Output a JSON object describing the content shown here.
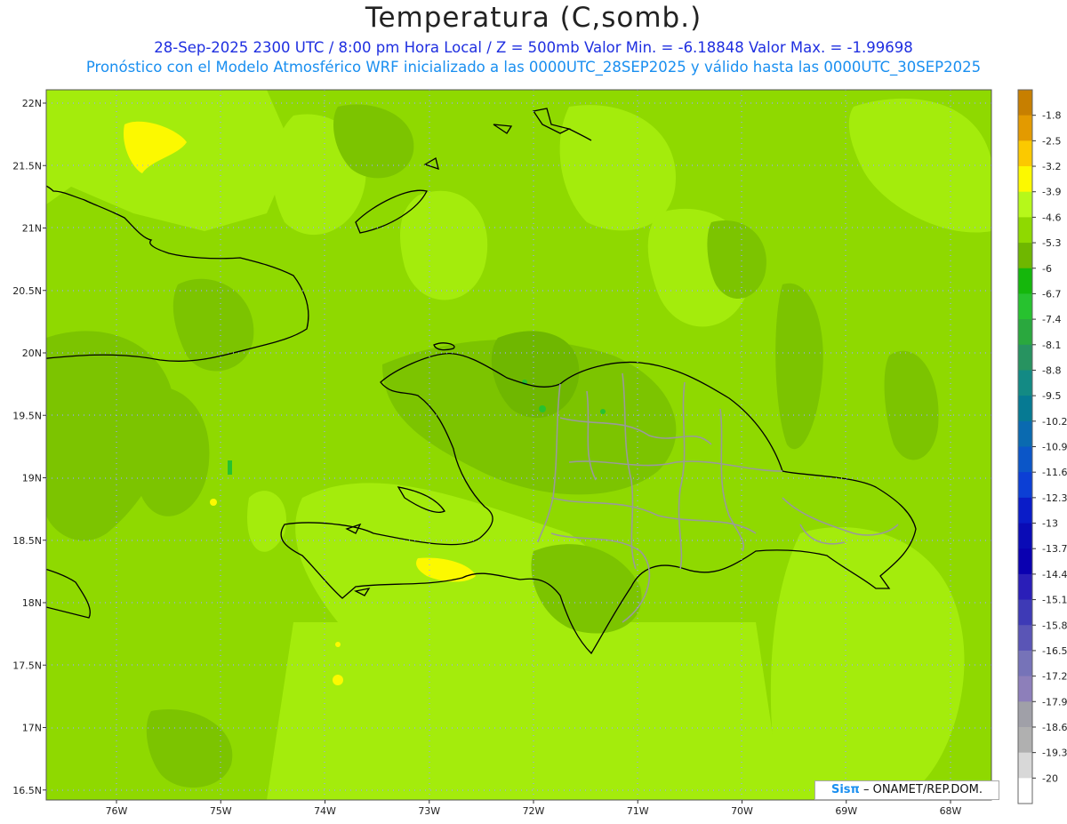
{
  "header": {
    "title": "Temperatura (C,somb.)",
    "line1": "28-Sep-2025  2300 UTC / 8:00 pm Hora Local / Z = 500mb  Valor Min. = -6.18848  Valor Max. = -1.99698",
    "line2": "Pronóstico con el Modelo Atmosférico WRF inicializado a las 0000UTC_28SEP2025 y válido hasta las  0000UTC_30SEP2025"
  },
  "map": {
    "lat_labels": [
      "22N",
      "21.5N",
      "21N",
      "20.5N",
      "20N",
      "19.5N",
      "19N",
      "18.5N",
      "18N",
      "17.5N",
      "17N",
      "16.5N"
    ],
    "lon_labels": [
      "76W",
      "75W",
      "74W",
      "73W",
      "72W",
      "71W",
      "70W",
      "69W",
      "68W"
    ]
  },
  "legend": {
    "labels": [
      "-1.8",
      "-2.5",
      "-3.2",
      "-3.9",
      "-4.6",
      "-5.3",
      "-6",
      "-6.7",
      "-7.4",
      "-8.1",
      "-8.8",
      "-9.5",
      "-10.2",
      "-10.9",
      "-11.6",
      "-12.3",
      "-13",
      "-13.7",
      "-14.4",
      "-15.1",
      "-15.8",
      "-16.5",
      "-17.2",
      "-17.9",
      "-18.6",
      "-19.3",
      "-20"
    ],
    "colors": [
      "#c77f00",
      "#e39a00",
      "#fbc900",
      "#fcf900",
      "#b6f81a",
      "#8fd900",
      "#6fb700",
      "#15b70c",
      "#27c22f",
      "#2aa83e",
      "#279360",
      "#138a84",
      "#067a93",
      "#0a6ab0",
      "#0b56c8",
      "#0c3fd5",
      "#0a1cc8",
      "#0a0bb6",
      "#0a00b0",
      "#2a1eb8",
      "#3e3ab6",
      "#5a55b6",
      "#7673b8",
      "#8d7fba",
      "#a0a0a8",
      "#b0b0b0",
      "#d8d8d8",
      "#ffffff"
    ]
  },
  "credit": {
    "logo": "Sisπ",
    "text": "– ONAMET/REP.DOM."
  }
}
